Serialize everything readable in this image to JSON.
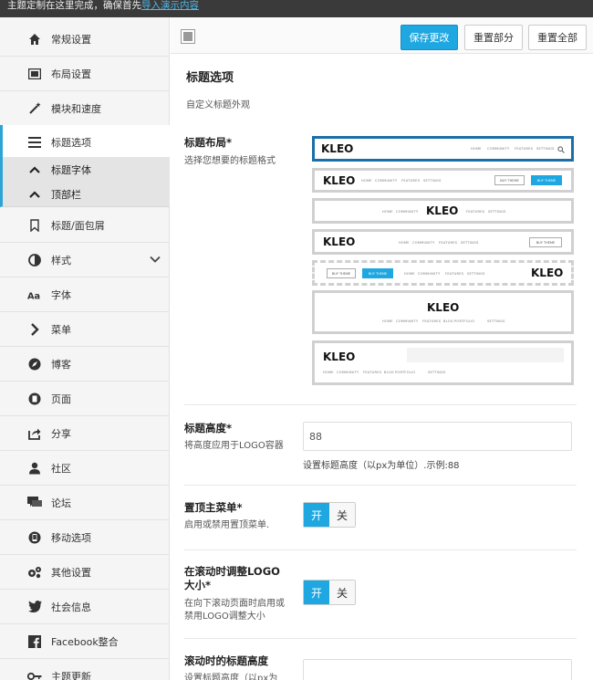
{
  "notice": {
    "text": "主题定制在这里完成，确保首先",
    "link": "导入演示内容"
  },
  "sidebar": {
    "items": [
      {
        "label": "常规设置",
        "icon": "home-icon"
      },
      {
        "label": "布局设置",
        "icon": "layout-icon"
      },
      {
        "label": "模块和速度",
        "icon": "magic-wand-icon"
      },
      {
        "label": "标题选项",
        "icon": "menu-bars-icon"
      },
      {
        "label": "标题/面包屑",
        "icon": "bookmark-icon"
      },
      {
        "label": "样式",
        "icon": "contrast-icon"
      },
      {
        "label": "字体",
        "icon": "font-icon"
      },
      {
        "label": "菜单",
        "icon": "chevron-right-icon"
      },
      {
        "label": "博客",
        "icon": "compass-icon"
      },
      {
        "label": "页面",
        "icon": "page-icon"
      },
      {
        "label": "分享",
        "icon": "share-icon"
      },
      {
        "label": "社区",
        "icon": "user-icon"
      },
      {
        "label": "论坛",
        "icon": "chat-icon"
      },
      {
        "label": "移动选项",
        "icon": "mobile-icon"
      },
      {
        "label": "其他设置",
        "icon": "gears-icon"
      },
      {
        "label": "社会信息",
        "icon": "twitter-icon"
      },
      {
        "label": "Facebook整合",
        "icon": "facebook-icon"
      },
      {
        "label": "主题更新",
        "icon": "key-icon"
      }
    ],
    "subitems": [
      {
        "label": "标题字体"
      },
      {
        "label": "顶部栏"
      }
    ]
  },
  "toolbar": {
    "save": "保存更改",
    "reset_section": "重置部分",
    "reset_all": "重置全部"
  },
  "section": {
    "title": "标题选项",
    "desc": "自定义标题外观"
  },
  "header_layout": {
    "title": "标题布局*",
    "desc": "选择您想要的标题格式",
    "logo": "KLEO",
    "nav": [
      "HOME",
      "COMMUNITY",
      "FEATURES",
      "SETTINGS"
    ],
    "nav_long": [
      "HOME",
      "COMMUNITY",
      "FEATURES",
      "BLOG",
      "PORTFOLIO",
      "SETTINGS"
    ],
    "btn_outline": "BUY THEME",
    "btn_fill": "BUY THEME",
    "selected_index": 0
  },
  "header_height": {
    "title": "标题高度*",
    "desc": "将高度应用于LOGO容器",
    "value": "88",
    "hint": "设置标题高度（以px为单位）.示例:88"
  },
  "sticky_menu": {
    "title": "置顶主菜单*",
    "desc": "启用或禁用置顶菜单.",
    "on": "开",
    "off": "关"
  },
  "resize_logo": {
    "title_line1": "在滚动时调整LOGO",
    "title_line2": "大小*",
    "desc_line1": "在向下滚动页面时启用或",
    "desc_line2": "禁用LOGO调整大小",
    "on": "开",
    "off": "关"
  },
  "scroll_height": {
    "title": "滚动时的标题高度",
    "desc": "设置标题高度（以px为"
  },
  "colors": {
    "accent": "#1ea7e1",
    "active_border": "#2ea3d6",
    "selected_card": "#1b6fa8"
  }
}
